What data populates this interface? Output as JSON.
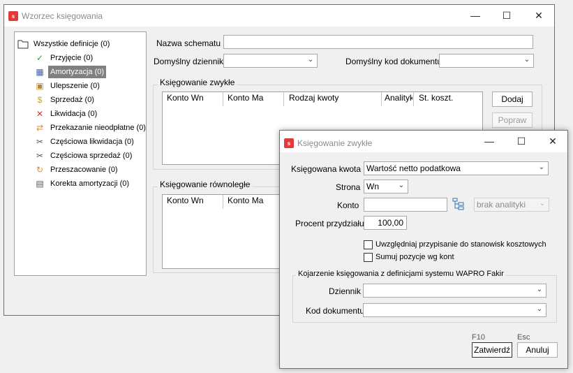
{
  "main_window": {
    "title": "Wzorzec księgowania",
    "icon": "wapro-logo-icon",
    "tree": {
      "root": "Wszystkie definicje (0)",
      "items": [
        {
          "label": "Przyjęcie (0)",
          "icon": "checkmark-icon",
          "color": "#2e9e3e"
        },
        {
          "label": "Amortyzacja (0)",
          "icon": "calculator-icon",
          "color": "#3b5fa8",
          "selected": true
        },
        {
          "label": "Ulepszenie (0)",
          "icon": "toolbox-icon",
          "color": "#b58a2e"
        },
        {
          "label": "Sprzedaż (0)",
          "icon": "money-icon",
          "color": "#c9a227"
        },
        {
          "label": "Likwidacja (0)",
          "icon": "red-x-icon",
          "color": "#d93030"
        },
        {
          "label": "Przekazanie nieodpłatne (0)",
          "icon": "transfer-icon",
          "color": "#e08a2a"
        },
        {
          "label": "Częściowa likwidacja (0)",
          "icon": "partial-liquidation-icon",
          "color": "#555555"
        },
        {
          "label": "Częściowa sprzedaż (0)",
          "icon": "partial-sale-icon",
          "color": "#555555"
        },
        {
          "label": "Przeszacowanie (0)",
          "icon": "revaluation-icon",
          "color": "#e08a2a"
        },
        {
          "label": "Korekta amortyzacji (0)",
          "icon": "correction-icon",
          "color": "#555555"
        }
      ]
    },
    "form": {
      "scheme_name_label": "Nazwa schematu",
      "scheme_name_value": "",
      "default_journal_label": "Domyślny dziennik",
      "default_journal_value": "",
      "default_doc_code_label": "Domyślny kod dokumentu",
      "default_doc_code_value": ""
    },
    "normal_posting": {
      "title": "Księgowanie zwykłe",
      "columns": [
        "Konto Wn",
        "Konto Ma",
        "Rodzaj kwoty",
        "Analityka",
        "St. koszt."
      ],
      "add_button": "Dodaj",
      "edit_button": "Popraw"
    },
    "parallel_posting": {
      "title": "Księgowanie równoległe",
      "columns": [
        "Konto Wn",
        "Konto Ma"
      ]
    }
  },
  "dialog": {
    "title": "Księgowanie zwykłe",
    "amount_label": "Księgowana kwota",
    "amount_value": "Wartość netto podatkowa",
    "side_label": "Strona",
    "side_value": "Wn",
    "account_label": "Konto",
    "account_value": "",
    "analytics_value": "brak analityki",
    "percent_label": "Procent przydziału",
    "percent_value": "100,00",
    "checkbox_cost_centers": "Uwzględniaj przypisanie do stanowisk kosztowych",
    "checkbox_sum_positions": "Sumuj pozycje wg kont",
    "fakir_group_title": "Kojarzenie księgowania z definicjami systemu WAPRO Fakir",
    "journal_label": "Dziennik",
    "journal_value": "",
    "doc_code_label": "Kod dokumentu",
    "doc_code_value": "",
    "confirm_hotkey": "F10",
    "cancel_hotkey": "Esc",
    "confirm_button": "Zatwierdź",
    "cancel_button": "Anuluj"
  },
  "window_controls": {
    "minimize": "—",
    "maximize": "☐",
    "close": "✕"
  }
}
